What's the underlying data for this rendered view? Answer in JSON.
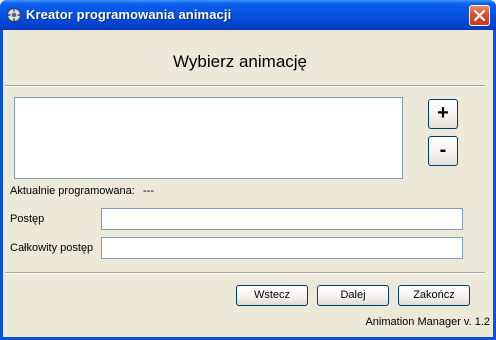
{
  "window": {
    "title": "Kreator programowania animacji",
    "icon": "app-icon",
    "close_icon": "close-icon"
  },
  "heading": "Wybierz animację",
  "animation_list": {
    "items": []
  },
  "list_buttons": {
    "add_label": "+",
    "remove_label": "-"
  },
  "status": {
    "current_label": "Aktualnie programowana:",
    "current_value": "---"
  },
  "progress": {
    "step_label": "Postęp",
    "step_value": "",
    "total_label": "Całkowity postęp",
    "total_value": ""
  },
  "footer_buttons": {
    "back": "Wstecz",
    "next": "Dalej",
    "finish": "Zakończ"
  },
  "version": "Animation Manager v. 1.2",
  "colors": {
    "titlebar": "#0553E0",
    "face": "#ECE9D8",
    "close": "#D8502B",
    "field_border": "#7F9DB9"
  }
}
